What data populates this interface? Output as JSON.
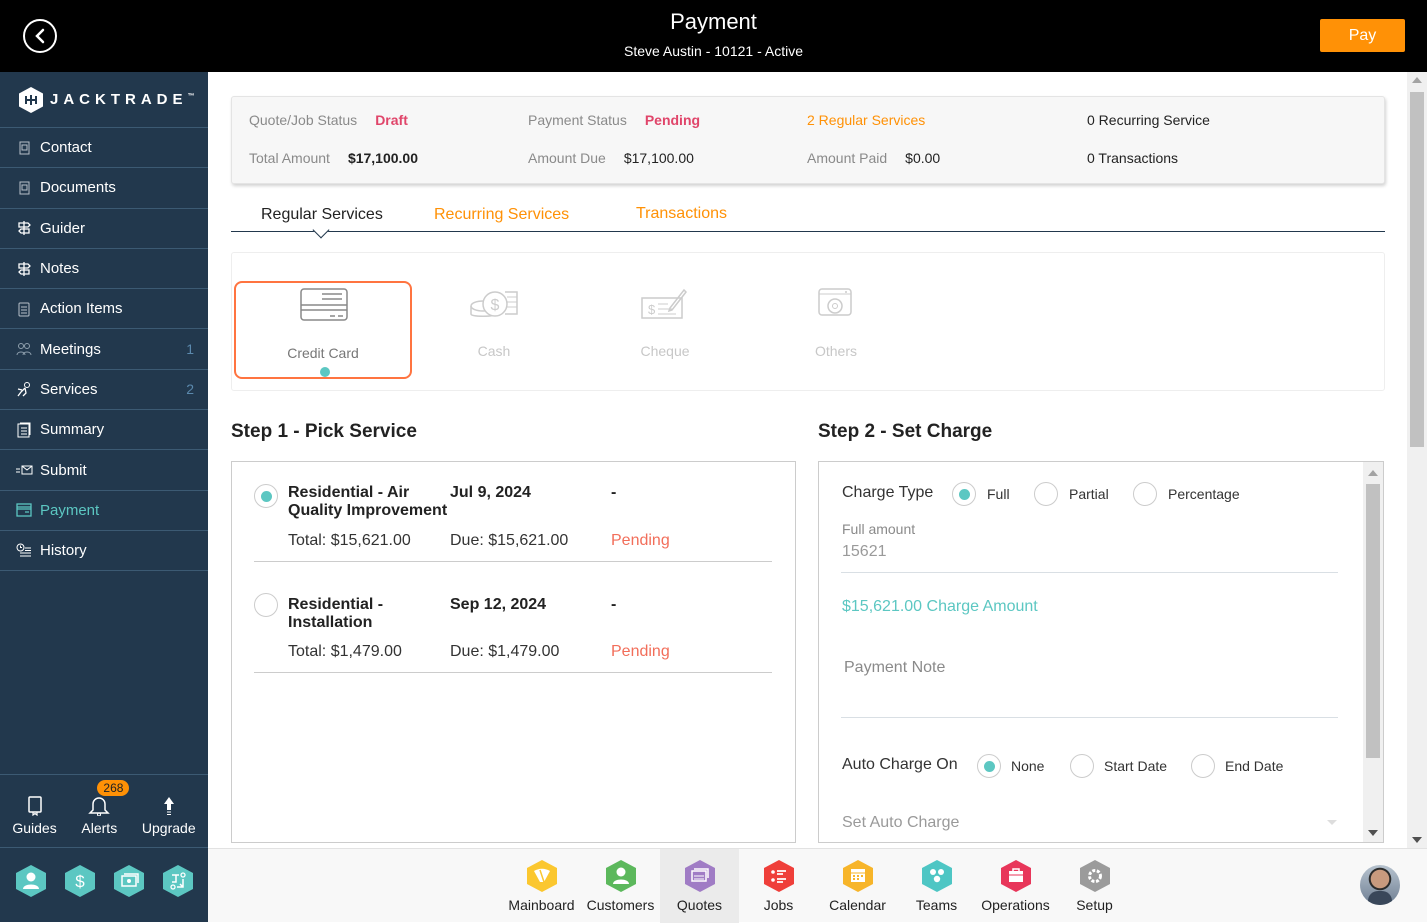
{
  "header": {
    "title": "Payment",
    "subtitle": "Steve Austin - 10121 - Active",
    "pay_label": "Pay",
    "back_icon": "chevron-left-circle-icon"
  },
  "sidebar": {
    "logo_text": "JACKTRADE",
    "logo_tm": "™",
    "items": [
      {
        "label": "Contact",
        "icon": "address-book-icon",
        "count": null
      },
      {
        "label": "Documents",
        "icon": "address-book-icon",
        "count": null
      },
      {
        "label": "Guider",
        "icon": "signpost-icon",
        "count": null
      },
      {
        "label": "Notes",
        "icon": "signpost-icon",
        "count": null
      },
      {
        "label": "Action Items",
        "icon": "clipboard-list-icon",
        "count": null
      },
      {
        "label": "Meetings",
        "icon": "meeting-icon",
        "count": "1"
      },
      {
        "label": "Services",
        "icon": "worker-icon",
        "count": "2"
      },
      {
        "label": "Summary",
        "icon": "document-stack-icon",
        "count": null
      },
      {
        "label": "Submit",
        "icon": "send-mail-icon",
        "count": null
      },
      {
        "label": "Payment",
        "icon": "payment-card-icon",
        "count": null,
        "active": true
      },
      {
        "label": "History",
        "icon": "history-icon",
        "count": null
      }
    ],
    "bottom": {
      "guides": "Guides",
      "alerts": "Alerts",
      "alerts_count": "268",
      "upgrade": "Upgrade"
    },
    "quick_icons": [
      "user-icon",
      "dollar-icon",
      "money-icon",
      "workflow-icon"
    ]
  },
  "summary": {
    "quote_status_label": "Quote/Job Status",
    "quote_status_value": "Draft",
    "payment_status_label": "Payment Status",
    "payment_status_value": "Pending",
    "regular_services": "2 Regular Services",
    "recurring_service": "0 Recurring Service",
    "total_amount_label": "Total Amount",
    "total_amount_value": "$17,100.00",
    "amount_due_label": "Amount Due",
    "amount_due_value": "$17,100.00",
    "amount_paid_label": "Amount Paid",
    "amount_paid_value": "$0.00",
    "transactions": "0 Transactions"
  },
  "tabs": [
    {
      "label": "Regular Services",
      "active": true
    },
    {
      "label": "Recurring Services",
      "active": false
    },
    {
      "label": "Transactions",
      "active": false
    }
  ],
  "payment_methods": [
    {
      "label": "Credit Card",
      "icon": "credit-card-icon",
      "selected": true
    },
    {
      "label": "Cash",
      "icon": "coins-icon",
      "selected": false
    },
    {
      "label": "Cheque",
      "icon": "cheque-icon",
      "selected": false
    },
    {
      "label": "Others",
      "icon": "wallet-icon",
      "selected": false
    }
  ],
  "step1": {
    "title": "Step 1 - Pick Service",
    "services": [
      {
        "name": "Residential - Air Quality Improvement",
        "date": "Jul 9, 2024",
        "extra": "-",
        "total": "Total: $15,621.00",
        "due": "Due: $15,621.00",
        "status": "Pending",
        "selected": true
      },
      {
        "name": "Residential - Installation",
        "date": "Sep 12, 2024",
        "extra": "-",
        "total": "Total: $1,479.00",
        "due": "Due: $1,479.00",
        "status": "Pending",
        "selected": false
      }
    ]
  },
  "step2": {
    "title": "Step 2 - Set Charge",
    "charge_type_label": "Charge Type",
    "charge_types": [
      {
        "label": "Full",
        "selected": true
      },
      {
        "label": "Partial",
        "selected": false
      },
      {
        "label": "Percentage",
        "selected": false
      }
    ],
    "full_amount_label": "Full amount",
    "full_amount_value": "15621",
    "charge_amount_text": "$15,621.00 Charge Amount",
    "payment_note_placeholder": "Payment Note",
    "auto_charge_label": "Auto Charge On",
    "auto_charge_options": [
      {
        "label": "None",
        "selected": true
      },
      {
        "label": "Start Date",
        "selected": false
      },
      {
        "label": "End Date",
        "selected": false
      }
    ],
    "set_auto_charge_placeholder": "Set Auto Charge"
  },
  "bottom_apps": [
    {
      "label": "Mainboard",
      "icon": "mainboard-icon",
      "color": "#fbc72f"
    },
    {
      "label": "Customers",
      "icon": "customer-icon",
      "color": "#5cb85c"
    },
    {
      "label": "Quotes",
      "icon": "quotes-icon",
      "color": "#a07cc5",
      "active": true
    },
    {
      "label": "Jobs",
      "icon": "jobs-list-icon",
      "color": "#ef3f3a"
    },
    {
      "label": "Calendar",
      "icon": "calendar-icon",
      "color": "#f7b52a"
    },
    {
      "label": "Teams",
      "icon": "teams-icon",
      "color": "#4ec6c4"
    },
    {
      "label": "Operations",
      "icon": "briefcase-icon",
      "color": "#e8365a"
    },
    {
      "label": "Setup",
      "icon": "gear-icon",
      "color": "#9b9b9b"
    }
  ],
  "colors": {
    "accent_teal": "#5cc7c2",
    "accent_orange": "#ff9106",
    "sidebar_bg": "#22384d",
    "status_red": "#e0456a",
    "selected_border": "#ff7440"
  }
}
